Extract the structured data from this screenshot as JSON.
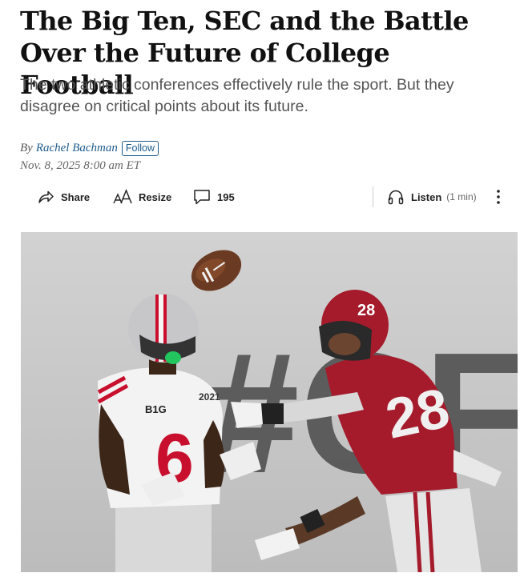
{
  "article": {
    "headline": "The Big Ten, SEC and the Battle Over the Future of College Football",
    "dek": "The two athletic conferences effectively rule the sport. But they disagree on critical points about its future.",
    "byline_prefix": "By",
    "author": "Rachel Bachman",
    "follow_label": "Follow",
    "date": "Nov. 8, 2025 8:00 am ET"
  },
  "toolbar": {
    "share_label": "Share",
    "share_icon": "share-icon",
    "resize_label": "Resize",
    "resize_icon": "text-size-icon",
    "comments_count": "195",
    "comments_icon": "comment-icon",
    "listen_label": "Listen",
    "listen_duration": "(1 min)",
    "listen_icon": "headphones-icon",
    "more_icon": "more-vertical-icon"
  },
  "photo": {
    "background_text": "#CF",
    "left_jersey_number": "6",
    "right_jersey_number": "28",
    "left_patch": "B1G",
    "left_badge": "2021",
    "colors": {
      "ohio_state_scarlet": "#c8102e",
      "alabama_crimson": "#a51b2b",
      "backdrop_gray": "#c9c9c9"
    }
  },
  "colors": {
    "link_blue": "#1d5a8c",
    "dek_gray": "#555555"
  }
}
